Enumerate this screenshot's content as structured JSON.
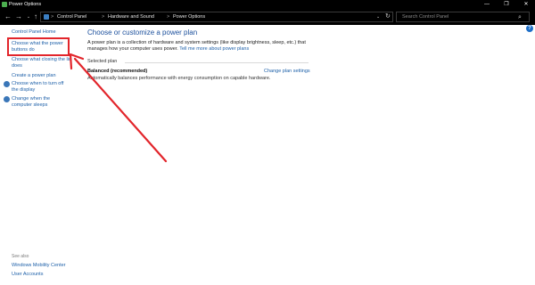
{
  "window": {
    "title": "Power Options",
    "minimize_glyph": "—",
    "maximize_glyph": "❐",
    "close_glyph": "✕"
  },
  "nav": {
    "back_glyph": "←",
    "forward_glyph": "→",
    "recent_glyph": "⌄",
    "up_glyph": "↑"
  },
  "address": {
    "breadcrumbs": [
      "Control Panel",
      "Hardware and Sound",
      "Power Options"
    ],
    "separator": ">",
    "dropdown_glyph": "⌄",
    "refresh_glyph": "↻"
  },
  "search": {
    "placeholder": "Search Control Panel",
    "icon_glyph": "⌕"
  },
  "help": {
    "glyph": "?"
  },
  "left_pane": {
    "home": "Control Panel Home",
    "links": [
      "Choose what the power buttons do",
      "Choose what closing the lid does",
      "Create a power plan",
      "Choose when to turn off the display",
      "Change when the computer sleeps"
    ],
    "see_also_title": "See also",
    "see_also": [
      "Windows Mobility Center",
      "User Accounts"
    ]
  },
  "main": {
    "heading": "Choose or customize a power plan",
    "description": "A power plan is a collection of hardware and system settings (like display brightness, sleep, etc.) that manages how your computer uses power.",
    "description_link": "Tell me more about power plans",
    "selected_plan_label": "Selected plan",
    "plan_name": "Balanced (recommended)",
    "plan_description": "Automatically balances performance with energy consumption on capable hardware.",
    "change_plan_link": "Change plan settings"
  },
  "colors": {
    "titlebar": "#000000",
    "link": "#1c5fa8",
    "heading": "#1b4f9c",
    "highlight": "#e2252b"
  }
}
